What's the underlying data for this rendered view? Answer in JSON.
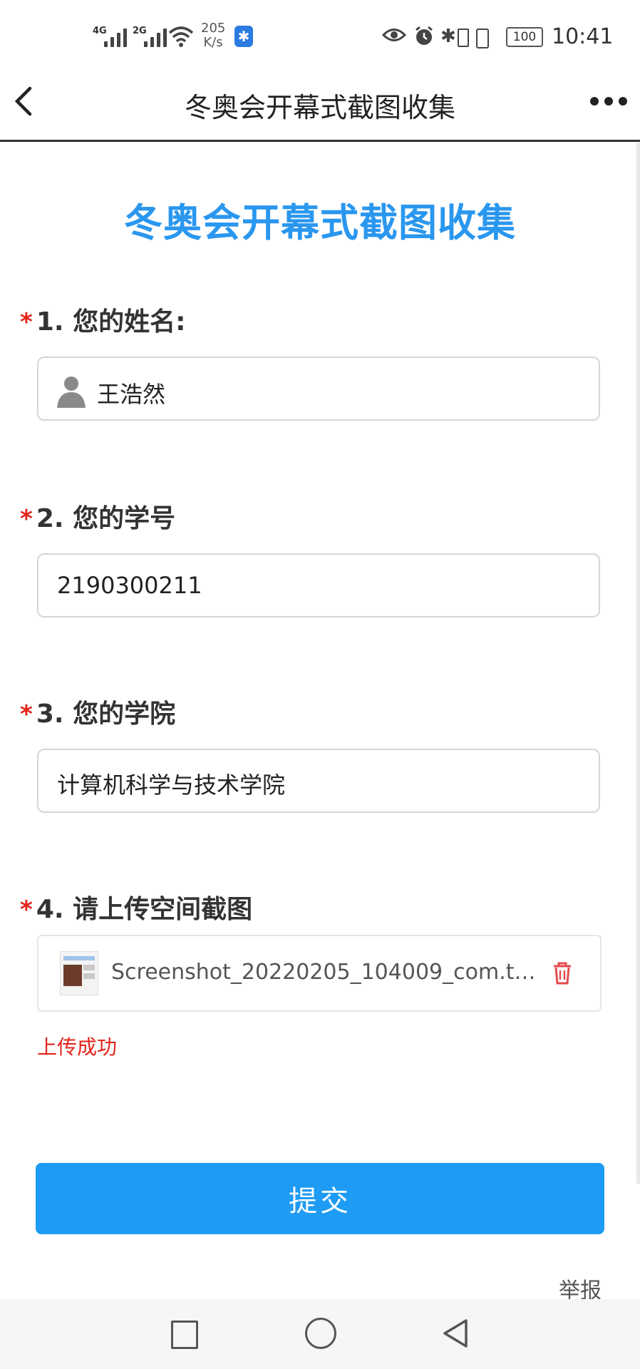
{
  "status_bar": {
    "net1": "4G",
    "net2": "2G",
    "speed_value": "205",
    "speed_unit": "K/s",
    "battery": "100",
    "time": "10:41"
  },
  "nav": {
    "title": "冬奥会开幕式截图收集"
  },
  "form": {
    "title": "冬奥会开幕式截图收集",
    "questions": [
      {
        "required": "*",
        "label": "1. 您的姓名:",
        "value": "王浩然"
      },
      {
        "required": "*",
        "label": "2. 您的学号",
        "value": "2190300211"
      },
      {
        "required": "*",
        "label": "3. 您的学院",
        "value": "计算机科学与技术学院"
      },
      {
        "required": "*",
        "label": "4. 请上传空间截图"
      }
    ],
    "upload": {
      "file_name": "Screenshot_20220205_104009_com.tencent…",
      "status": "上传成功"
    },
    "submit_label": "提交",
    "report_label": "举报"
  },
  "colors": {
    "accent_blue": "#1e9bf4",
    "title_blue": "#2a97ef",
    "required_red": "#e2231a"
  }
}
